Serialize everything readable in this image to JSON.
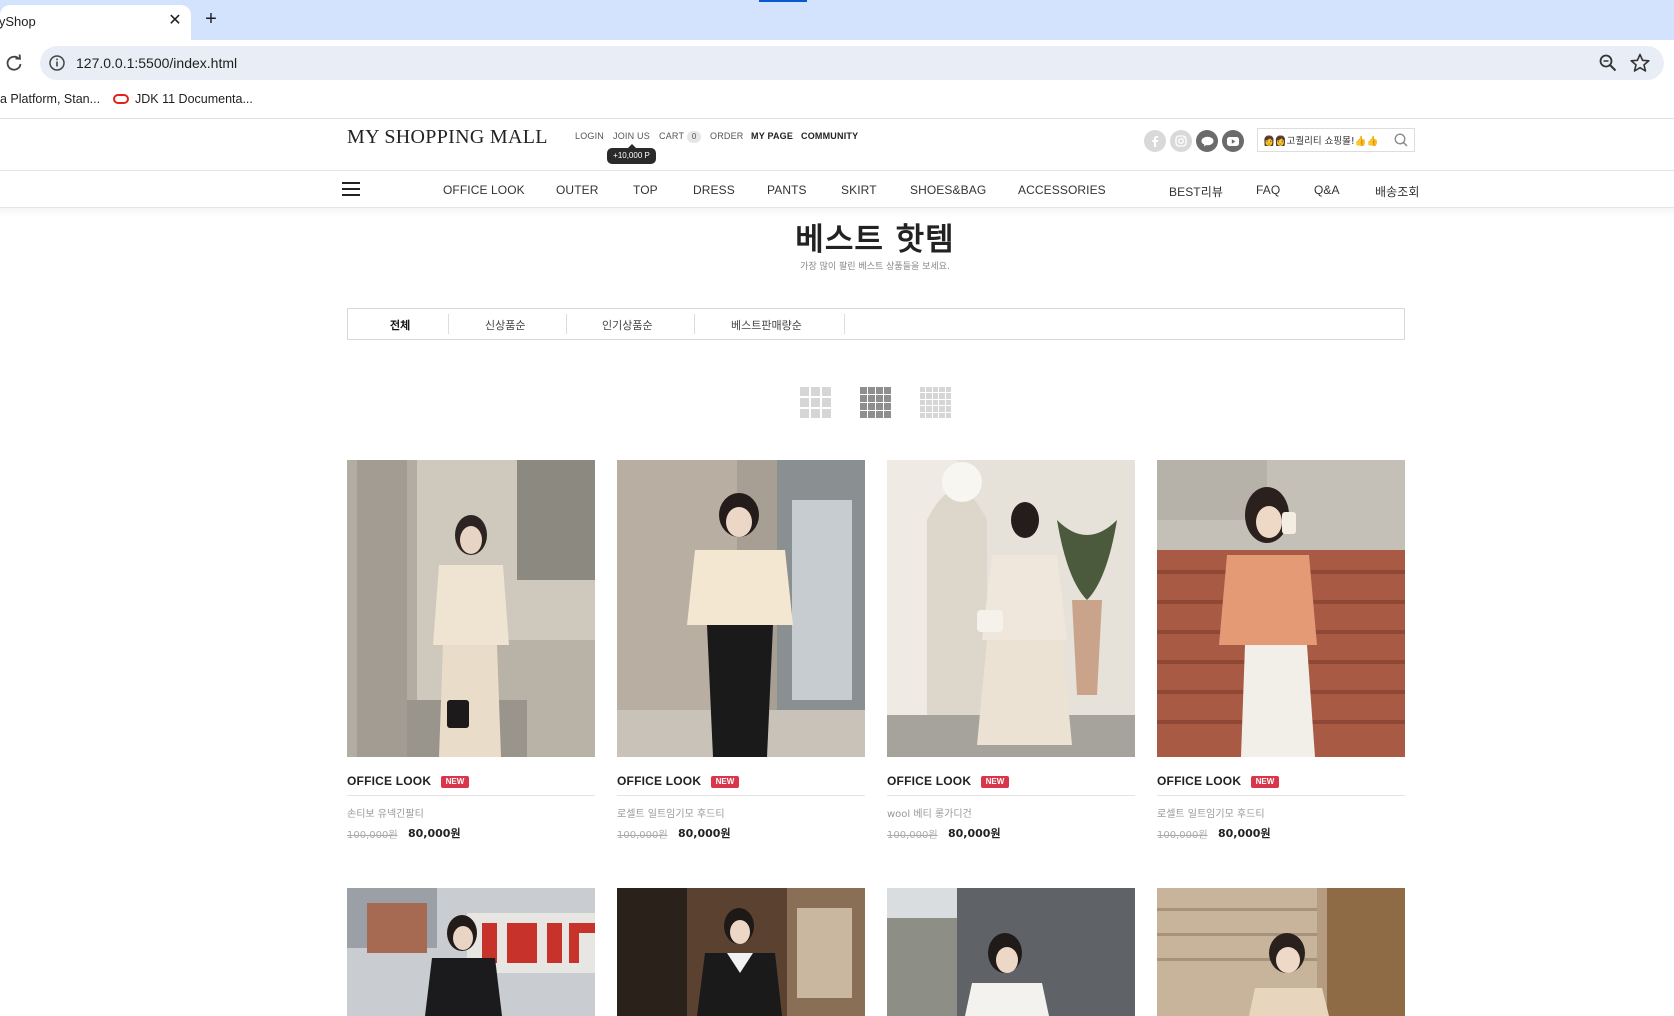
{
  "browser": {
    "tab_title": "MyShop",
    "url": "127.0.0.1:5500/index.html",
    "bookmarks": [
      "a Platform, Stan...",
      "JDK 11 Documenta..."
    ]
  },
  "header": {
    "logo": "MY SHOPPING MALL",
    "top_links": {
      "login": "LOGIN",
      "join": "JOIN US",
      "cart": "CART",
      "cart_count": "0",
      "order": "ORDER",
      "mypage": "MY PAGE",
      "community": "COMMUNITY"
    },
    "join_bonus": "+10,000 P",
    "search_value": "👩‍👩고퀄리티 쇼핑몰!👍👍",
    "categories": [
      "OFFICE LOOK",
      "OUTER",
      "TOP",
      "DRESS",
      "PANTS",
      "SKIRT",
      "SHOES&BAG",
      "ACCESSORIES"
    ],
    "extra_links": [
      "BEST리뷰",
      "FAQ",
      "Q&A",
      "배송조회"
    ]
  },
  "best": {
    "title": "베스트 핫템",
    "subtitle": "가장 많이 팔린 베스트 상품들을 보세요.",
    "sort_tabs": [
      "전체",
      "신상품순",
      "인기상품순",
      "베스트판매량순"
    ]
  },
  "products": [
    {
      "category": "OFFICE LOOK",
      "badge": "NEW",
      "name": "손티보 유넥긴팔티",
      "original_price": "100,000원",
      "price": "80,000원"
    },
    {
      "category": "OFFICE LOOK",
      "badge": "NEW",
      "name": "로셀트 일트임기모 후드티",
      "original_price": "100,000원",
      "price": "80,000원"
    },
    {
      "category": "OFFICE LOOK",
      "badge": "NEW",
      "name": "wool 베티 롱가디건",
      "original_price": "100,000원",
      "price": "80,000원"
    },
    {
      "category": "OFFICE LOOK",
      "badge": "NEW",
      "name": "로셀트 일트임기모 후드티",
      "original_price": "100,000원",
      "price": "80,000원"
    }
  ],
  "colors": {
    "accent_badge": "#d8364a",
    "chrome_tab_strip": "#d3e3fd",
    "omnibox": "#e9eef6"
  }
}
